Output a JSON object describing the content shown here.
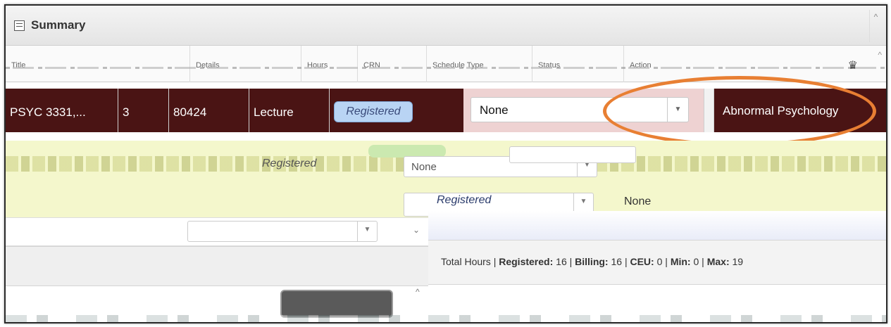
{
  "header": {
    "title": "Summary",
    "icon": "summary-table-icon"
  },
  "columns": [
    {
      "label": "Title"
    },
    {
      "label": "Details"
    },
    {
      "label": "Hours"
    },
    {
      "label": "CRN"
    },
    {
      "label": "Schedule Type"
    },
    {
      "label": "Status"
    },
    {
      "label": "Action"
    }
  ],
  "selected_row": {
    "course": "PSYC 3331,...",
    "hours": "3",
    "crn": "80424",
    "schedule_type": "Lecture",
    "status": "Registered",
    "action": "None",
    "title": "Abnormal Psychology"
  },
  "partial_rows": [
    {
      "status": "Registered",
      "action": "None"
    },
    {
      "status": "Registered",
      "action": "None"
    }
  ],
  "totals": {
    "prefix": "Total Hours |",
    "registered_label": "Registered:",
    "registered": "16",
    "billing_label": "Billing:",
    "billing": "16",
    "ceu_label": "CEU:",
    "ceu": "0",
    "min_label": "Min:",
    "min": "0",
    "max_label": "Max:",
    "max": "19"
  },
  "colors": {
    "row_selected": "#4a1414",
    "highlight": "#e87f33",
    "status_badge": "#b9d4f4",
    "action_cell": "#eed2d2",
    "row_yellow": "#f4f7cc"
  }
}
